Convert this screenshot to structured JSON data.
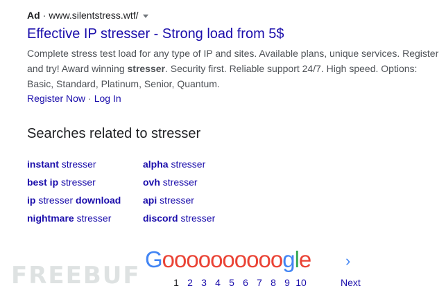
{
  "ad": {
    "label": "Ad",
    "separator": "·",
    "url": "www.silentstress.wtf/",
    "title": "Effective IP stresser - Strong load from 5$",
    "description_part1": "Complete stress test load for any type of IP and sites. Available plans, unique services. Register and try! Award winning ",
    "description_bold": "stresser",
    "description_part2": ". Security first. Reliable support 24/7. High speed. Options: Basic, Standard, Platinum, Senior, Quantum.",
    "sitelinks": [
      "Register Now",
      "Log In"
    ],
    "sitelink_separator": "·"
  },
  "related": {
    "title": "Searches related to stresser",
    "items": [
      {
        "bold": "instant",
        "rest": " stresser"
      },
      {
        "bold": "alpha",
        "rest": " stresser"
      },
      {
        "bold": "best ip",
        "rest": " stresser"
      },
      {
        "bold": "ovh",
        "rest": " stresser"
      },
      {
        "bold": "ip",
        "rest": " stresser ",
        "bold2": "download"
      },
      {
        "bold": "api",
        "rest": " stresser"
      },
      {
        "bold": "nightmare",
        "rest": " stresser"
      },
      {
        "bold": "discord",
        "rest": " stresser"
      }
    ]
  },
  "pagination": {
    "logo": {
      "first": "G",
      "os": "oooooooooo",
      "g": "g",
      "l": "l",
      "e": "e"
    },
    "pages": [
      "1",
      "2",
      "3",
      "4",
      "5",
      "6",
      "7",
      "8",
      "9",
      "10"
    ],
    "current_page": "1",
    "next_label": "Next",
    "next_arrow": "›"
  },
  "watermark": {
    "text": "FREEBUF"
  },
  "colors": {
    "link": "#1a0dab",
    "text": "#202124",
    "snippet": "#4d5156",
    "google_blue": "#4285f4",
    "google_red": "#ea4335",
    "google_yellow": "#fbbc05",
    "google_green": "#34a853"
  }
}
